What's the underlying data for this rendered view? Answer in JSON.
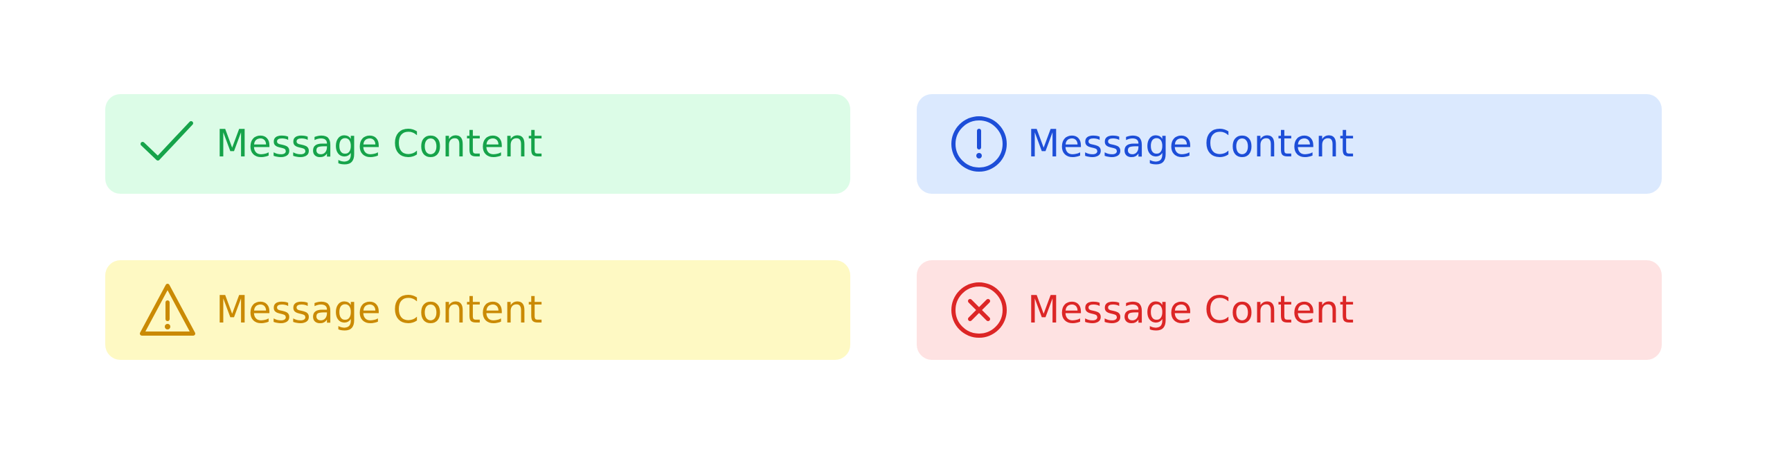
{
  "alerts": {
    "success": {
      "message": "Message Content",
      "icon": "check-icon",
      "text_color": "#16a34a",
      "background": "#dcfce7"
    },
    "info": {
      "message": "Message Content",
      "icon": "exclamation-circle-icon",
      "text_color": "#1d4ed8",
      "background": "#dbe9fe"
    },
    "warning": {
      "message": "Message Content",
      "icon": "warning-triangle-icon",
      "text_color": "#ca8a04",
      "background": "#fef9c3"
    },
    "error": {
      "message": "Message Content",
      "icon": "x-circle-icon",
      "text_color": "#dc2626",
      "background": "#fee2e2"
    }
  }
}
